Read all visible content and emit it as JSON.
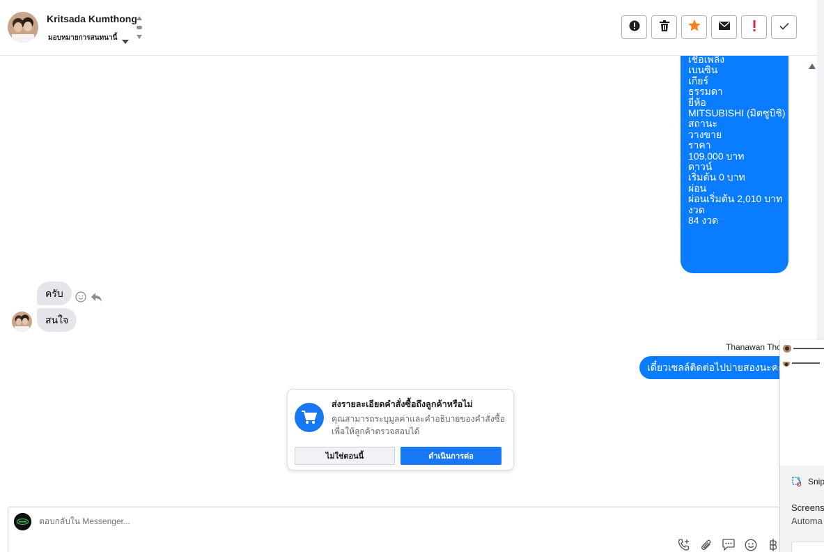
{
  "header": {
    "contact_name": "Kritsada Kumthong",
    "assign_label": "มอบหมายการสนทนานี้",
    "actions": [
      {
        "icon": "alert-circle-icon",
        "name": "spam-button"
      },
      {
        "icon": "trash-icon",
        "name": "delete-button"
      },
      {
        "icon": "star-icon",
        "name": "star-button"
      },
      {
        "icon": "mail-icon",
        "name": "mark-unread-button"
      },
      {
        "icon": "exclamation-icon",
        "name": "follow-up-button"
      },
      {
        "icon": "check-icon",
        "name": "done-button"
      }
    ]
  },
  "conversation": {
    "details_lines": [
      "เชื้อเพลิง",
      "เบนซิน",
      "เกียร์",
      "ธรรมดา",
      "ยี่ห้อ",
      "MITSUBISHI (มิตซูบิชิ)",
      "สถานะ",
      "วางขาย",
      "ราคา",
      "109,000 บาท",
      "ดาวน์",
      "เริ่มต้น 0 บาท",
      "ผ่อน",
      "ผ่อนเริ่มต้น 2,010 บาท",
      "งวด",
      "84 งวด"
    ],
    "incoming": [
      {
        "text": "ครับ"
      },
      {
        "text": "สนใจ"
      }
    ],
    "outgoing_sender": "Thanawan Tho",
    "outgoing_message": "เดี๋ยวเซลล์ติดต่อไปบ่ายสองนะคะ"
  },
  "order_card": {
    "title": "ส่งรายละเอียดคำสั่งซื้อถึงลูกค้าหรือไม่",
    "description": "คุณสามารถระบุมูลค่าและคำอธิบายของคำสั่งซื้อ เพื่อให้ลูกค้าตรวจสอบได้",
    "decline_label": "ไม่ใช่ตอนนี้",
    "proceed_label": "ดำเนินการต่อ"
  },
  "composer": {
    "placeholder": "ตอบกลับใน Messenger..."
  },
  "snip": {
    "app_name": "Snip",
    "line1": "Screens",
    "line2": "Automa"
  },
  "colors": {
    "accent": "#1877f2",
    "outgoing_bubble": "#0a7cff",
    "incoming_bubble": "#e4e6eb",
    "star": "#f5821f",
    "alert": "#e41e3f"
  }
}
